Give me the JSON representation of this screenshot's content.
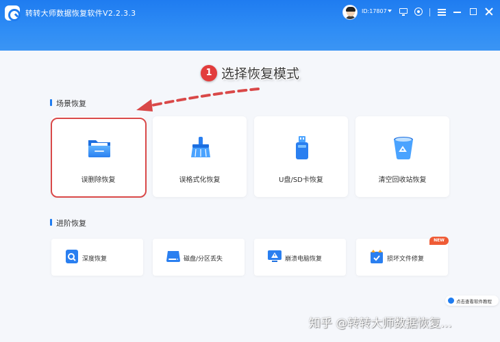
{
  "app": {
    "title": "转转大师数据恢复软件V2.2.3.3"
  },
  "user": {
    "id": "ID:17807"
  },
  "annotation": {
    "step": "1",
    "text": "选择恢复模式"
  },
  "sections": {
    "scene": {
      "title": "场景恢复"
    },
    "advanced": {
      "title": "进阶恢复"
    }
  },
  "scene_cards": [
    {
      "label": "误删除恢复",
      "icon": "folder-icon"
    },
    {
      "label": "误格式化恢复",
      "icon": "broom-icon"
    },
    {
      "label": "U盘/SD卡恢复",
      "icon": "usb-drive-icon"
    },
    {
      "label": "清空回收站恢复",
      "icon": "recycle-bin-icon"
    }
  ],
  "advanced_cards": [
    {
      "label": "深度恢复",
      "icon": "deep-scan-icon"
    },
    {
      "label": "磁盘/分区丢失",
      "icon": "disk-icon"
    },
    {
      "label": "崩溃电脑恢复",
      "icon": "crashed-computer-icon"
    },
    {
      "label": "损坏文件修复",
      "icon": "repair-file-icon"
    }
  ],
  "badges": {
    "new": "NEW"
  },
  "help": {
    "text": "点击查看软件教程"
  },
  "watermark": {
    "text": "知乎 @转转大师数据恢复..."
  },
  "colors": {
    "brand": "#1f7cf0",
    "highlight": "#d94848",
    "annotation": "#e23c3c",
    "new_badge": "#ef5b35"
  }
}
